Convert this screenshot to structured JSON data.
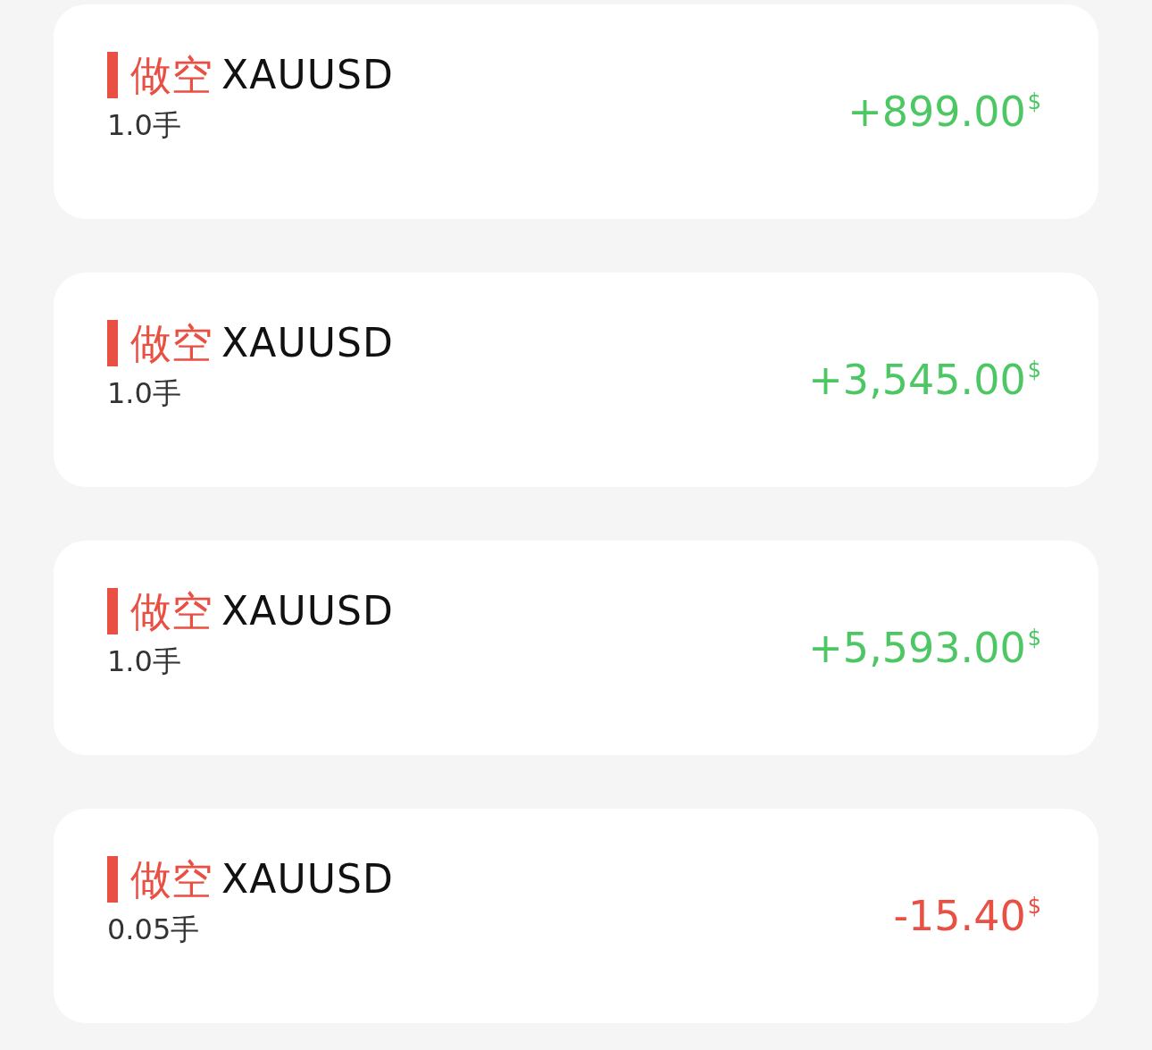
{
  "positions": [
    {
      "side": "做空",
      "symbol": "XAUUSD",
      "lots": "1.0手",
      "profit": "+899.00",
      "currency": "$",
      "kind": "gain"
    },
    {
      "side": "做空",
      "symbol": "XAUUSD",
      "lots": "1.0手",
      "profit": "+3,545.00",
      "currency": "$",
      "kind": "gain"
    },
    {
      "side": "做空",
      "symbol": "XAUUSD",
      "lots": "1.0手",
      "profit": "+5,593.00",
      "currency": "$",
      "kind": "gain"
    },
    {
      "side": "做空",
      "symbol": "XAUUSD",
      "lots": "0.05手",
      "profit": "-15.40",
      "currency": "$",
      "kind": "loss"
    }
  ]
}
